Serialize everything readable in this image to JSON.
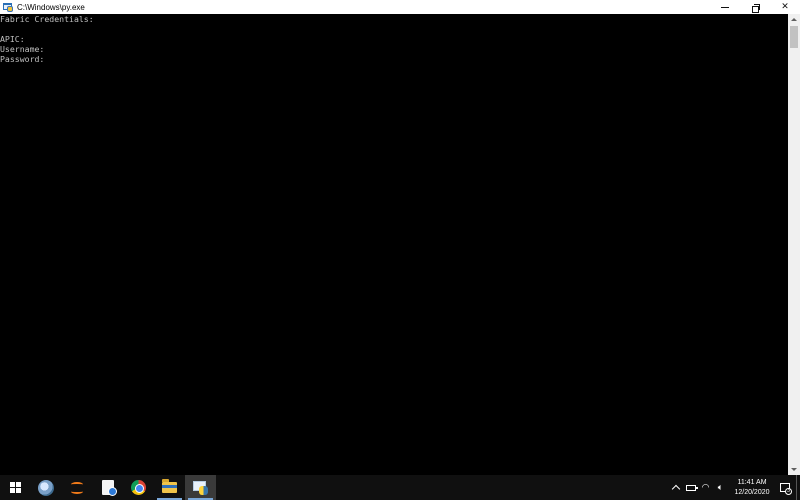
{
  "window": {
    "title": "C:\\Windows\\py.exe",
    "controls": {
      "minimize": "minimize",
      "maximize": "restore",
      "close": "✕"
    }
  },
  "console": {
    "lines": [
      "Fabric Credentials:",
      "",
      "APIC:",
      "Username:",
      "Password:"
    ]
  },
  "taskbar": {
    "apps": [
      {
        "name": "stellarium-icon"
      },
      {
        "name": "eclipse-icon"
      },
      {
        "name": "document-icon"
      },
      {
        "name": "chrome-icon"
      },
      {
        "name": "file-explorer-icon"
      },
      {
        "name": "python-console-icon",
        "active": true
      }
    ],
    "tray": {
      "time": "11:41 AM",
      "date": "12/20/2020",
      "notification_count": "3"
    }
  },
  "colors": {
    "console_bg": "#000000",
    "console_text": "#c0c0c0",
    "taskbar_bg": "#101010",
    "active_app_underline": "#7aa7d8"
  }
}
